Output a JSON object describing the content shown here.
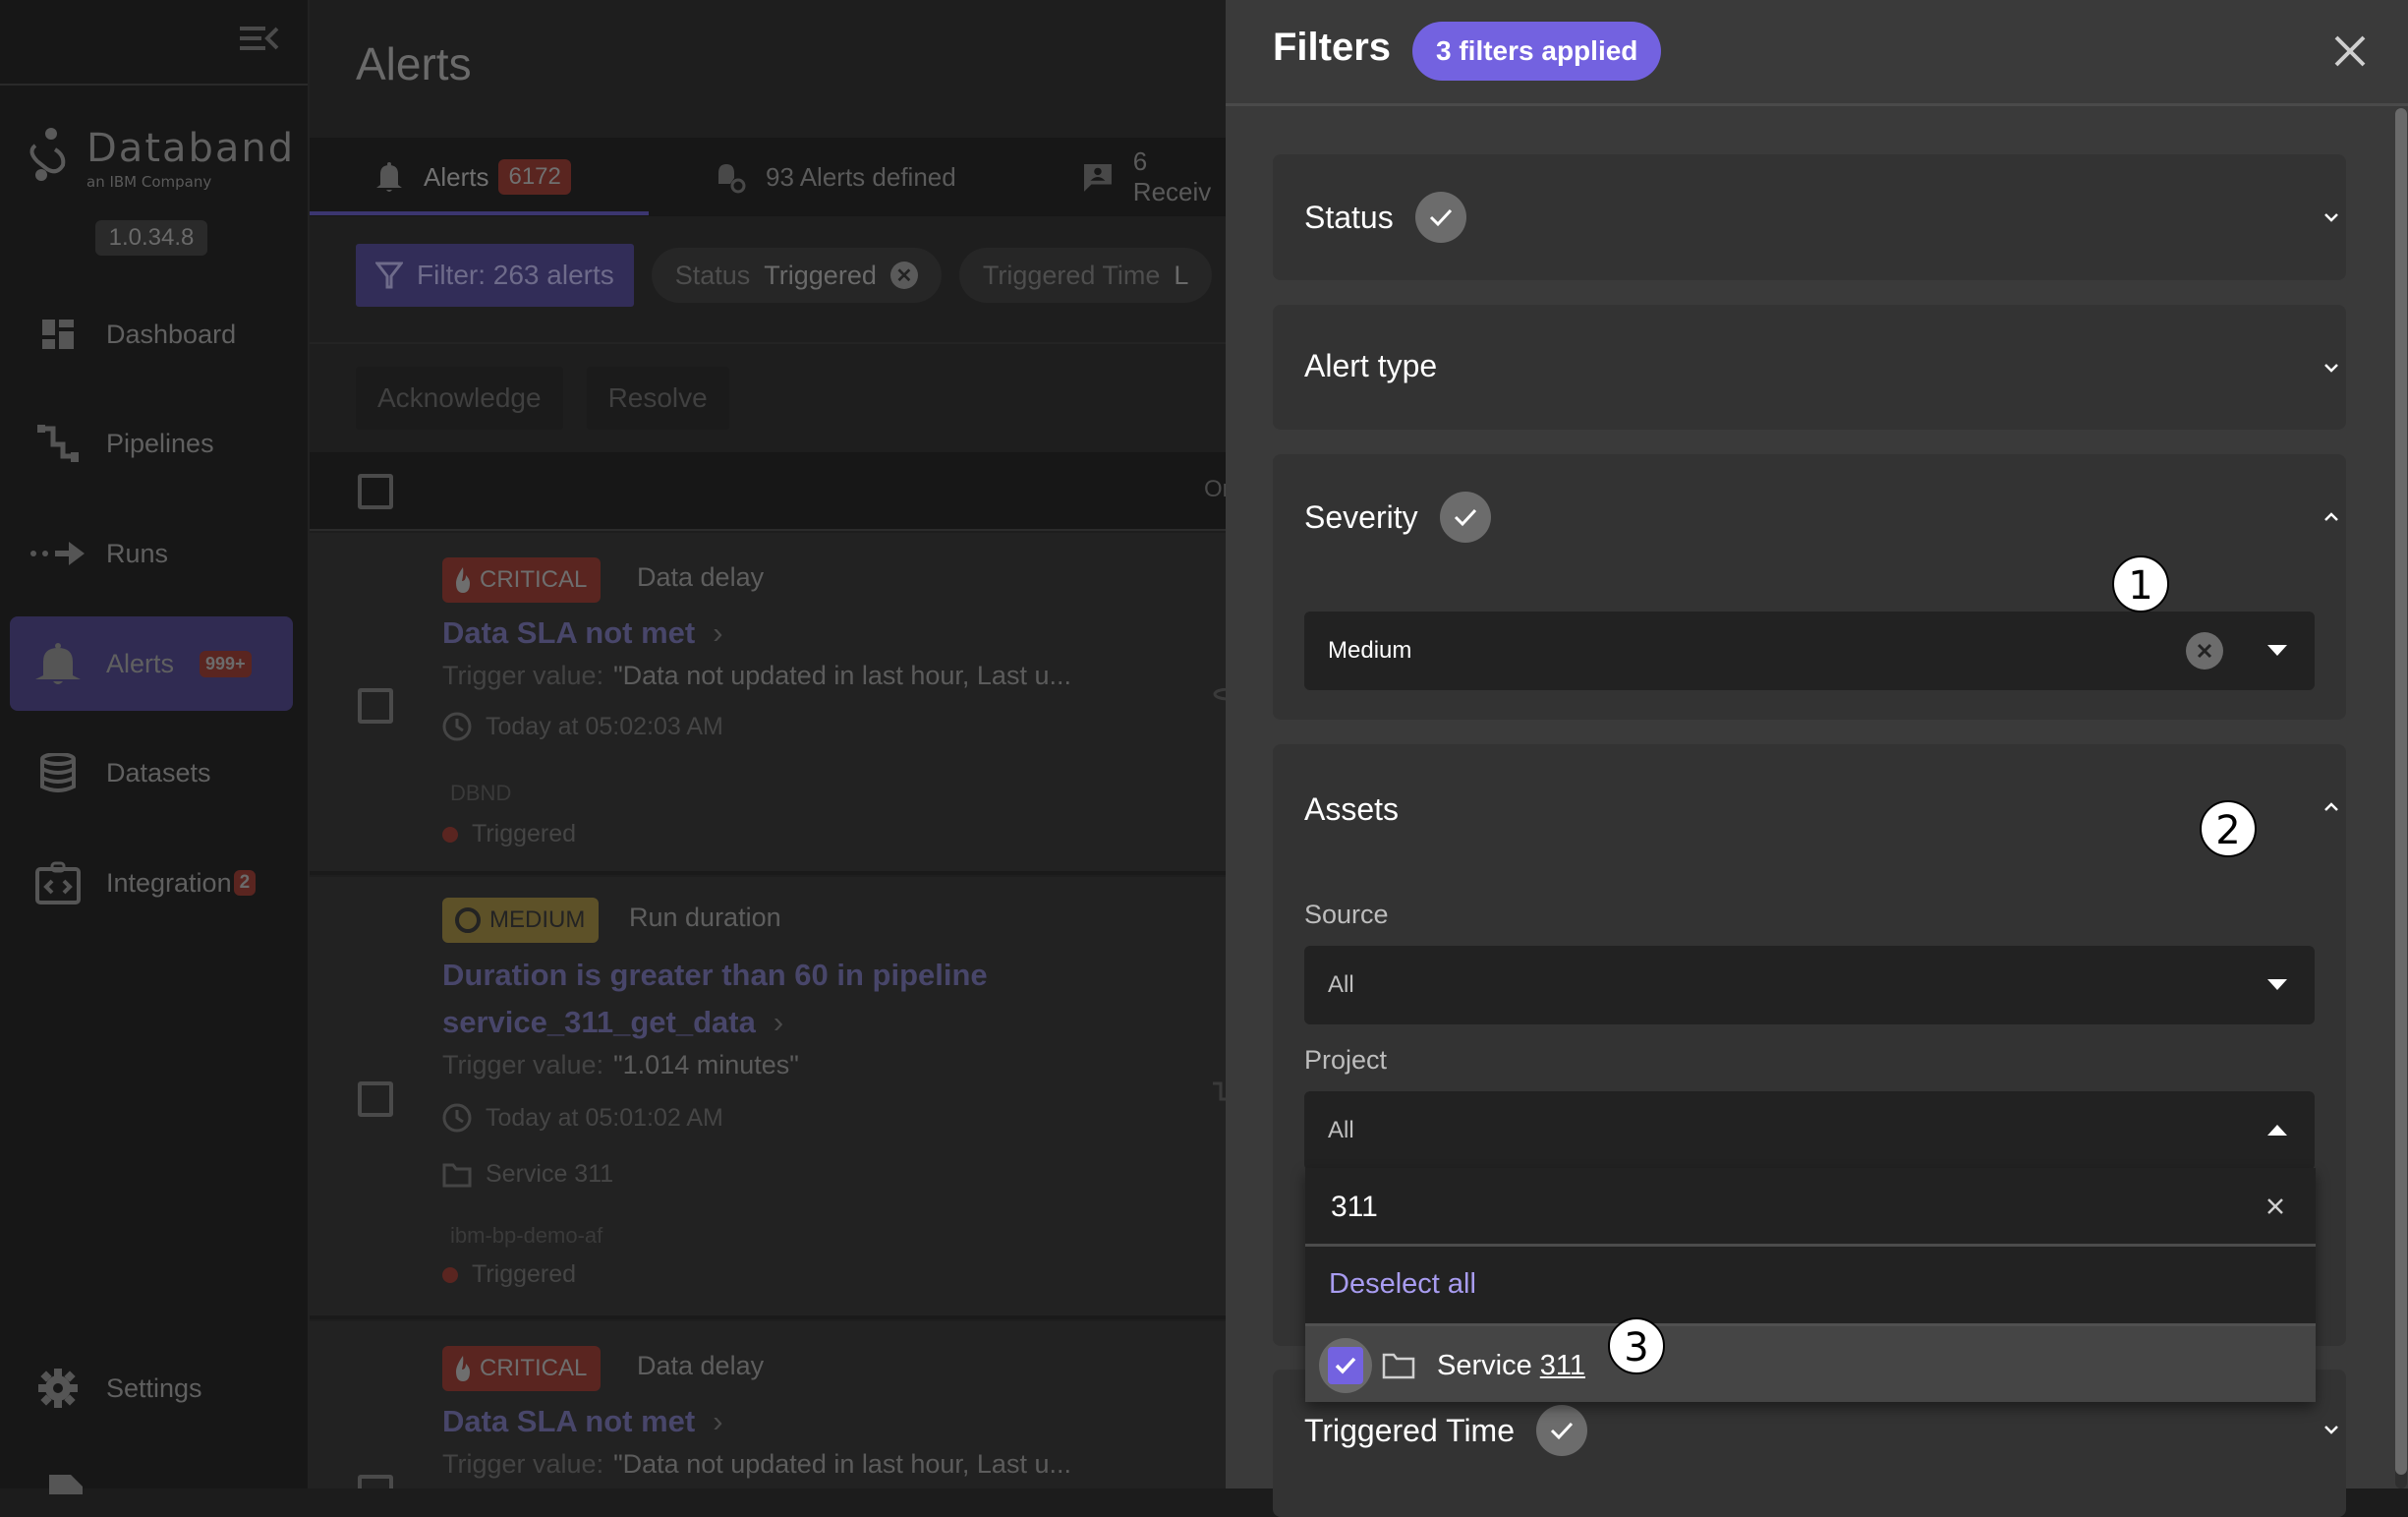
{
  "sidebar": {
    "brand": "Databand",
    "brand_sub": "an IBM Company",
    "version": "1.0.34.8",
    "items": [
      {
        "label": "Dashboard",
        "icon": "dashboard-icon"
      },
      {
        "label": "Pipelines",
        "icon": "pipelines-icon"
      },
      {
        "label": "Runs",
        "icon": "runs-icon"
      },
      {
        "label": "Alerts",
        "icon": "bell-icon",
        "badge": "999+",
        "active": true
      },
      {
        "label": "Datasets",
        "icon": "database-icon"
      },
      {
        "label": "Integration",
        "icon": "integration-icon",
        "badge": "2"
      }
    ],
    "settings_label": "Settings"
  },
  "main": {
    "title": "Alerts",
    "tabs": [
      {
        "label": "Alerts",
        "badge": "6172",
        "active": true
      },
      {
        "label": "93 Alerts defined"
      },
      {
        "label": "6 Receiv"
      }
    ],
    "filter_button": "Filter: 263 alerts",
    "chips": [
      {
        "key": "Status",
        "value": "Triggered"
      },
      {
        "key": "Triggered Time",
        "value": "L"
      }
    ],
    "actions": {
      "acknowledge": "Acknowledge",
      "resolve": "Resolve"
    },
    "list_header_order": "Or",
    "alerts": [
      {
        "severity": "CRITICAL",
        "type": "Data delay",
        "title": "Data SLA not met",
        "trigger_label": "Trigger value:",
        "trigger_value": "\"Data not updated in last hour, Last u...",
        "time": "Today at 05:02:03 AM",
        "source": "DBND",
        "status": "Triggered"
      },
      {
        "severity": "MEDIUM",
        "type": "Run duration",
        "title_line1": "Duration is greater than 60 in pipeline",
        "title_line2": "service_311_get_data",
        "trigger_label": "Trigger value:",
        "trigger_value": "\"1.014 minutes\"",
        "time": "Today at 05:01:02 AM",
        "project": "Service 311",
        "source": "ibm-bp-demo-af",
        "status": "Triggered"
      },
      {
        "severity": "CRITICAL",
        "type": "Data delay",
        "title": "Data SLA not met",
        "trigger_label": "Trigger value:",
        "trigger_value": "\"Data not updated in last hour, Last u..."
      }
    ]
  },
  "filters": {
    "title": "Filters",
    "applied": "3 filters applied",
    "sections": {
      "status": {
        "label": "Status",
        "applied": true,
        "expanded": false
      },
      "alert_type": {
        "label": "Alert type",
        "applied": false,
        "expanded": false
      },
      "severity": {
        "label": "Severity",
        "applied": true,
        "expanded": true,
        "selected": "Medium"
      },
      "assets": {
        "label": "Assets",
        "expanded": true,
        "source_label": "Source",
        "source_value": "All",
        "project_label": "Project",
        "project_value": "All",
        "project_search": "311",
        "deselect_all": "Deselect all",
        "options": [
          {
            "prefix": "Service ",
            "match": "311",
            "checked": true
          }
        ]
      },
      "triggered_time": {
        "label": "Triggered Time",
        "applied": true,
        "expanded": false
      }
    }
  },
  "markers": [
    "1",
    "2",
    "3"
  ],
  "colors": {
    "accent": "#7362e0",
    "critical": "#5a2520",
    "medium": "#5d5128",
    "panel_bg": "#3a3a3a"
  }
}
